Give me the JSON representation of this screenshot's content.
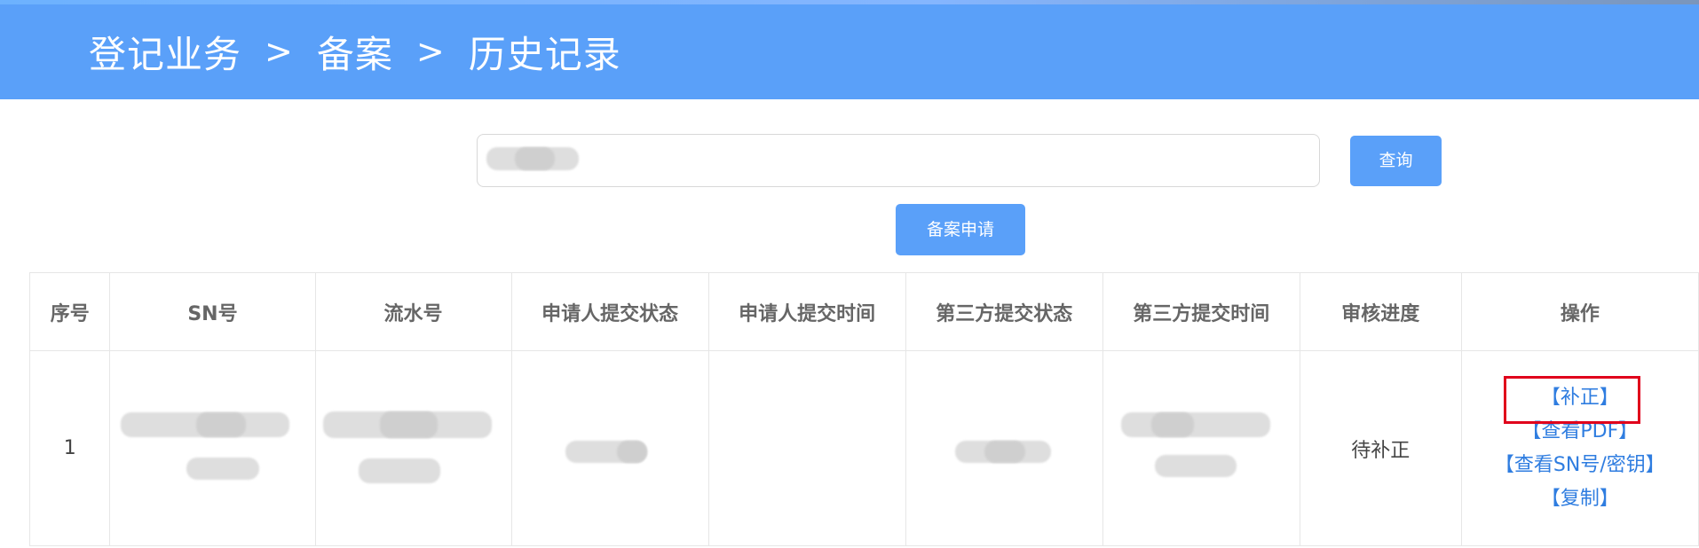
{
  "header": {
    "breadcrumb": {
      "first": "登记业务",
      "separator_1": ">",
      "second": "备案",
      "separator_2": ">",
      "third": "历史记录"
    }
  },
  "search": {
    "value": "",
    "placeholder": ""
  },
  "buttons": {
    "query": "查询",
    "filing_application": "备案申请"
  },
  "table": {
    "columns": [
      "序号",
      "SN号",
      "流水号",
      "申请人提交状态",
      "申请人提交时间",
      "第三方提交状态",
      "第三方提交时间",
      "审核进度",
      "操作"
    ],
    "rows": [
      {
        "index": "1",
        "review_progress": "待补正",
        "actions": [
          "【补正】",
          "【查看PDF】",
          "【查看SN号/密钥】",
          "【复制】"
        ]
      }
    ]
  },
  "colors": {
    "header_background": "#5aa0f9",
    "button_background": "#5aa0f9",
    "link_text": "#2f7de0",
    "highlight_border": "#e0001b"
  },
  "icons": []
}
